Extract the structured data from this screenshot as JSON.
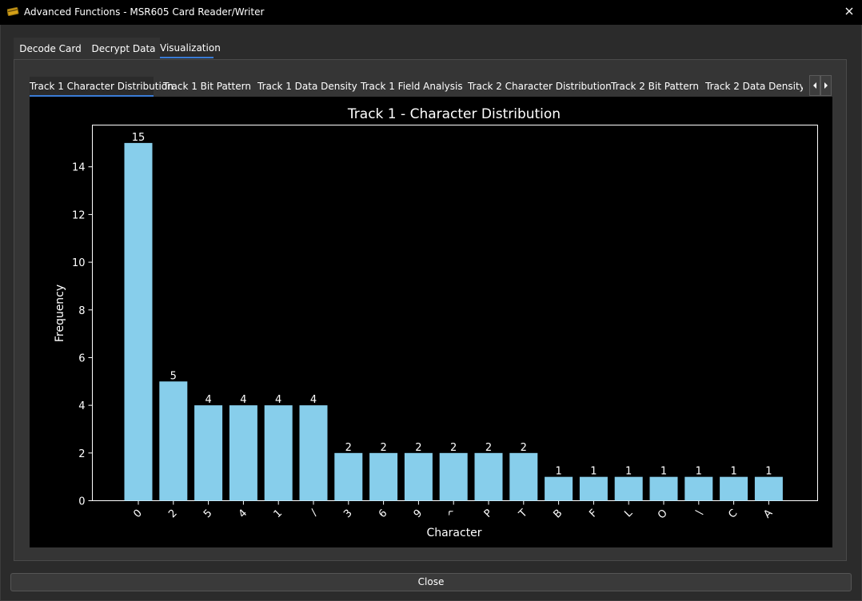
{
  "window": {
    "title": "Advanced Functions - MSR605 Card Reader/Writer",
    "app_icon": "credit-card-icon",
    "close_icon": "close-icon"
  },
  "outer_tabs": [
    {
      "label": "Decode Card",
      "active": false
    },
    {
      "label": "Decrypt Data",
      "active": false
    },
    {
      "label": "Visualization",
      "active": true
    }
  ],
  "inner_tabs": [
    {
      "label": "Track 1 Character Distribution",
      "active": true
    },
    {
      "label": "Track 1 Bit Pattern",
      "active": false
    },
    {
      "label": "Track 1 Data Density",
      "active": false
    },
    {
      "label": "Track 1 Field Analysis",
      "active": false
    },
    {
      "label": "Track 2 Character Distribution",
      "active": false
    },
    {
      "label": "Track 2 Bit Pattern",
      "active": false
    },
    {
      "label": "Track 2 Data Density",
      "active": false
    }
  ],
  "tab_scroll": {
    "left_icon": "arrow-left-icon",
    "right_icon": "arrow-right-icon"
  },
  "close_button": {
    "label": "Close"
  },
  "colors": {
    "bar": "#87ceeb",
    "accent": "#3a7bd5",
    "plot_bg": "#000000"
  },
  "chart_data": {
    "type": "bar",
    "title": "Track 1 - Character Distribution",
    "xlabel": "Character",
    "ylabel": "Frequency",
    "categories": [
      "0",
      "2",
      "5",
      "4",
      "1",
      "/",
      "3",
      "6",
      "9",
      "^",
      "P",
      "T",
      "B",
      "F",
      "L",
      "O",
      "\\",
      "C",
      "A"
    ],
    "values": [
      15,
      5,
      4,
      4,
      4,
      4,
      2,
      2,
      2,
      2,
      2,
      2,
      1,
      1,
      1,
      1,
      1,
      1,
      1
    ],
    "yticks": [
      0,
      2,
      4,
      6,
      8,
      10,
      12,
      14
    ],
    "ylim": [
      0,
      15.75
    ],
    "data_labels": true,
    "grid": false,
    "legend": false
  }
}
